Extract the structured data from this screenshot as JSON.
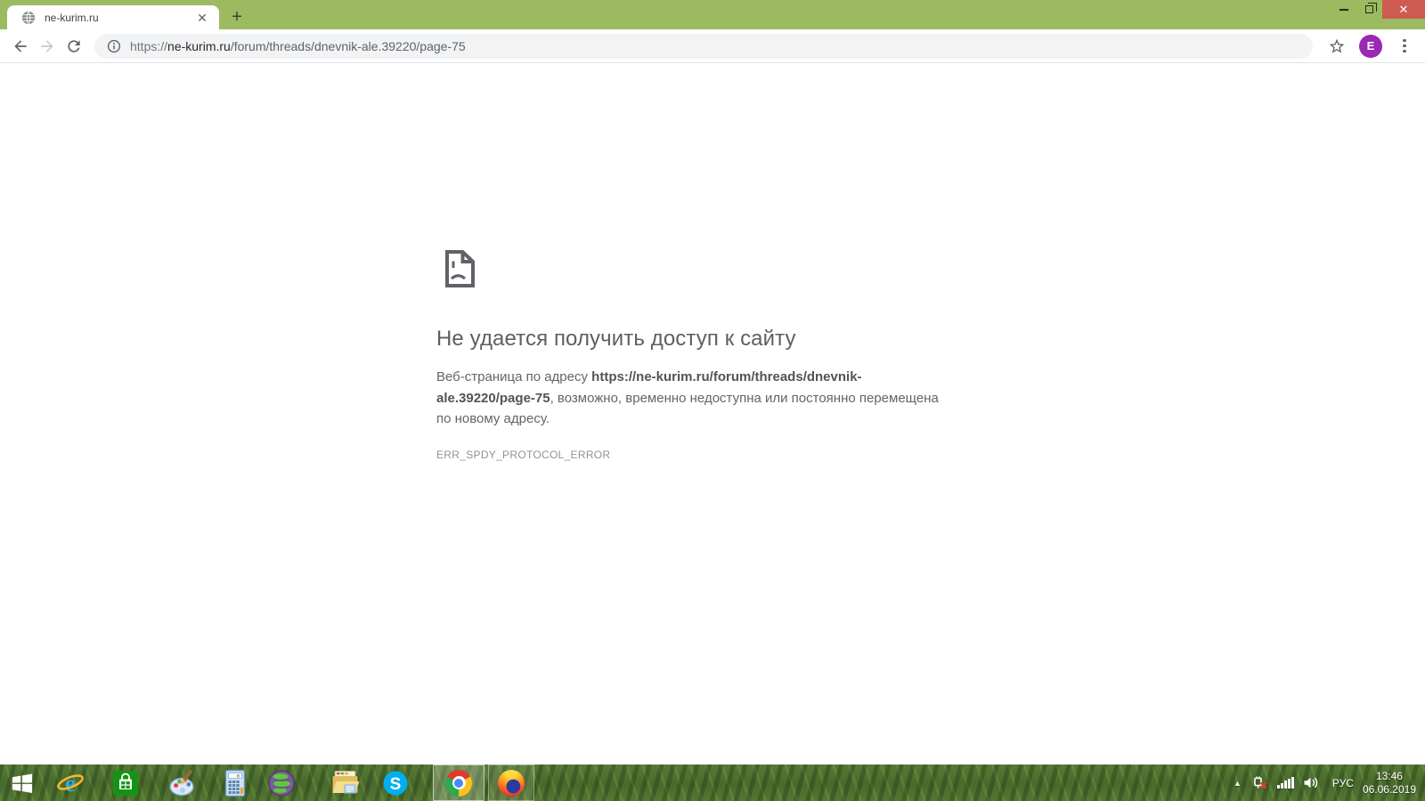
{
  "window": {
    "tab": {
      "title": "ne-kurim.ru",
      "favicon": "globe-icon",
      "close_glyph": "✕"
    },
    "new_tab_glyph": "+",
    "controls": {
      "close_glyph": "✕"
    },
    "theme_colors": {
      "frame_green": "#9cba5f",
      "close_red": "#cd5b52"
    }
  },
  "toolbar": {
    "url": {
      "scheme": "https://",
      "domain": "ne-kurim.ru",
      "path": "/forum/threads/dnevnik-ale.39220/page-75"
    },
    "avatar_letter": "E",
    "avatar_color": "#9c27b0"
  },
  "error_page": {
    "title": "Не удается получить доступ к сайту",
    "body_prefix": "Веб-страница по адресу ",
    "body_url": "https://ne-kurim.ru/forum/threads/dnevnik-ale.39220/page-75",
    "body_suffix": ", возможно, временно недоступна или постоянно перемещена по новому адресу.",
    "error_code": "ERR_SPDY_PROTOCOL_ERROR"
  },
  "taskbar": {
    "buttons": [
      {
        "name": "start"
      },
      {
        "name": "internet-explorer"
      },
      {
        "name": "microsoft-store"
      },
      {
        "name": "paint"
      },
      {
        "name": "calculator"
      },
      {
        "name": "tor-browser"
      },
      {
        "name": "file-explorer"
      },
      {
        "name": "skype"
      },
      {
        "name": "chrome",
        "state": "active"
      },
      {
        "name": "firefox",
        "state": "running"
      }
    ],
    "tray": {
      "language": "РУС",
      "time": "13:46",
      "date": "06.06.2019",
      "icons": [
        "show-hidden-icons",
        "network-disconnected",
        "signal-strength",
        "volume"
      ]
    }
  }
}
